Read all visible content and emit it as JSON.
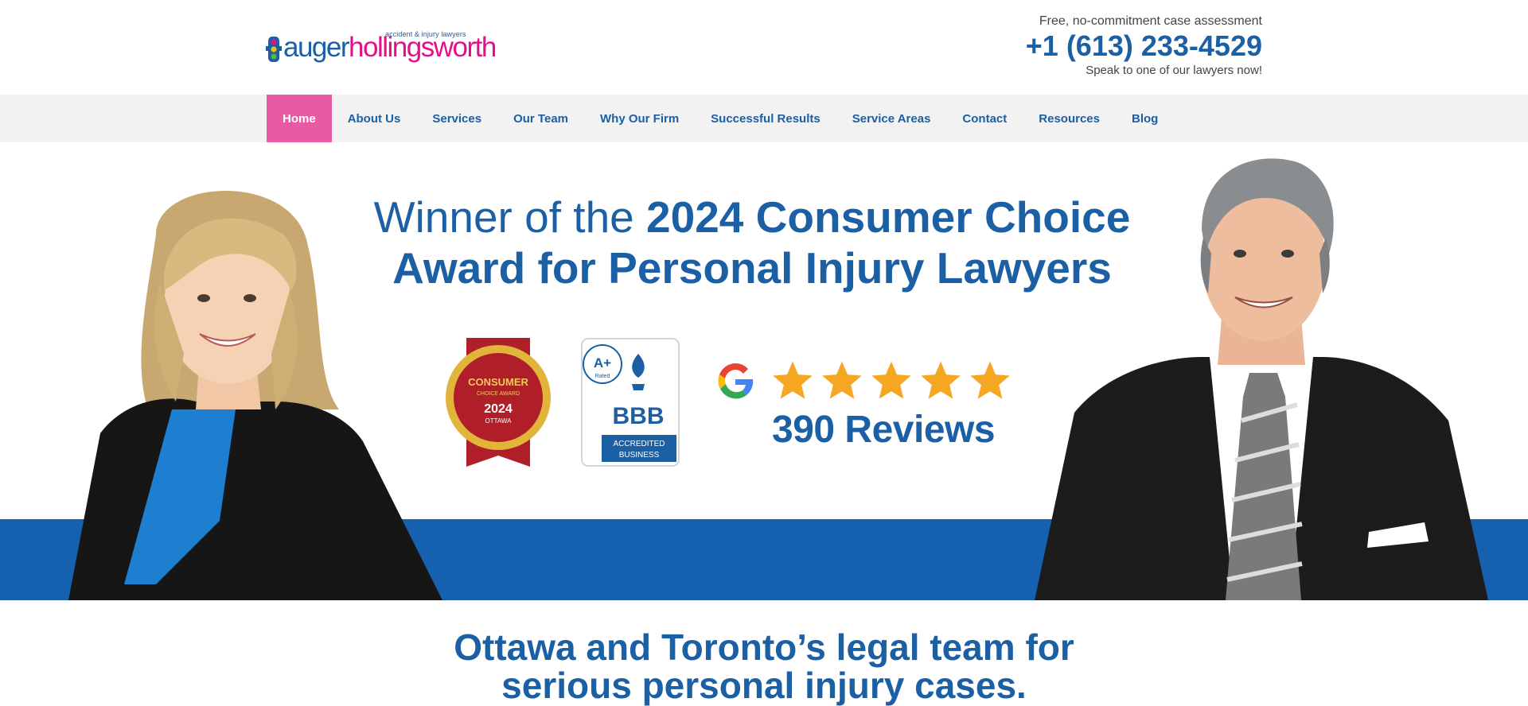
{
  "logo": {
    "word_part1": "auger",
    "word_part2": "hollingsworth",
    "tagline": "accident & injury lawyers"
  },
  "header": {
    "assessment_text": "Free, no-commitment case assessment",
    "phone": "+1 (613) 233-4529",
    "speak_text": "Speak to one of our lawyers now!"
  },
  "nav": {
    "items": [
      {
        "label": "Home",
        "active": true
      },
      {
        "label": "About Us"
      },
      {
        "label": "Services"
      },
      {
        "label": "Our Team"
      },
      {
        "label": "Why Our Firm"
      },
      {
        "label": "Successful Results"
      },
      {
        "label": "Service Areas"
      },
      {
        "label": "Contact"
      },
      {
        "label": "Resources"
      },
      {
        "label": "Blog"
      }
    ]
  },
  "hero": {
    "line1_prefix": "Winner of the ",
    "line1_bold": "2024 Consumer Choice",
    "line2": "Award for Personal Injury Lawyers",
    "consumer_badge": {
      "line1": "CONSUMER",
      "line2": "CHOICE AWARD",
      "year": "2024",
      "city": "OTTAWA"
    },
    "bbb_badge": {
      "rating": "A+",
      "rated": "Rated",
      "name": "BBB",
      "accredited1": "ACCREDITED",
      "accredited2": "BUSINESS"
    },
    "reviews": {
      "stars": 5,
      "count_text": "390 Reviews"
    }
  },
  "intro": {
    "line1": "Ottawa and Toronto’s legal team for",
    "line2": "serious personal injury cases."
  },
  "colors": {
    "brand_blue": "#1b5fa5",
    "brand_pink": "#e4108a",
    "nav_active": "#ea5aa4",
    "hero_band": "#1561b0",
    "star": "#f5a623"
  }
}
